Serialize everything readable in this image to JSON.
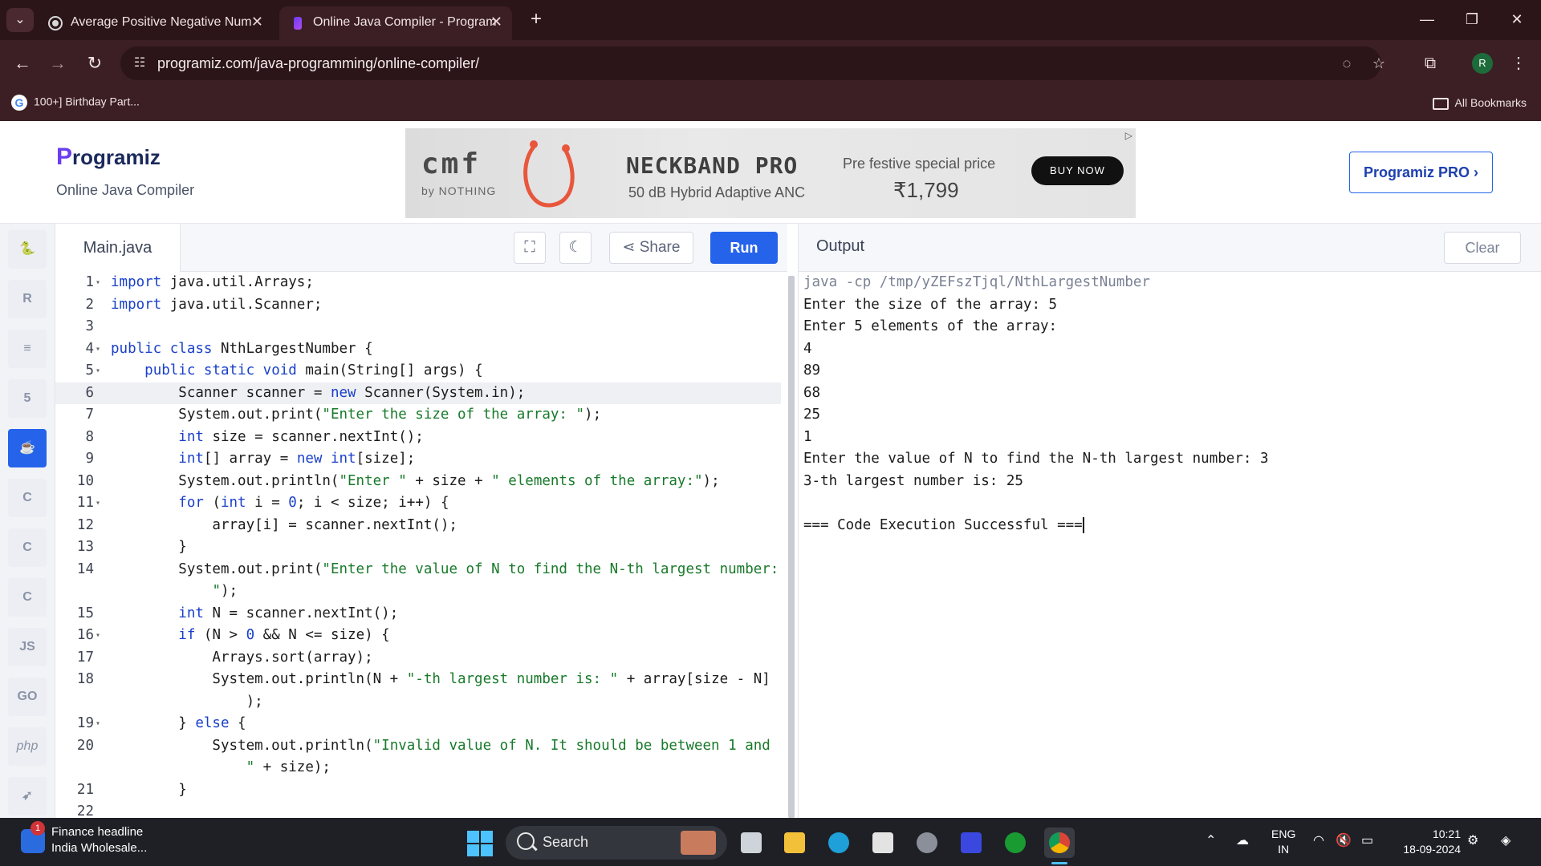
{
  "browser": {
    "tabs": [
      {
        "title": "Average Positive Negative Num"
      },
      {
        "title": "Online Java Compiler - Program"
      }
    ],
    "url": "programiz.com/java-programming/online-compiler/",
    "bookmark": "100+] Birthday Part...",
    "all_bookmarks": "All Bookmarks",
    "profile_initial": "R"
  },
  "site": {
    "logo": "rogramiz",
    "logo_p": "P",
    "subtitle": "Online Java Compiler",
    "pro_button": "Programiz PRO ›"
  },
  "ad": {
    "brand": "cmf",
    "brand_sub": "by NOTHING",
    "product": "NECKBAND PRO",
    "product_sub": "50 dB Hybrid Adaptive ANC",
    "promo": "Pre festive special price",
    "price": "₹1,799",
    "buy": "BUY NOW",
    "choices": "▷"
  },
  "languages": [
    "python-icon",
    "r-icon",
    "sql-icon",
    "html-icon",
    "java-icon",
    "c-icon",
    "cpp-icon",
    "csharp-icon",
    "JS",
    "GO",
    "php",
    "swift-icon"
  ],
  "editor": {
    "file": "Main.java",
    "share": "Share",
    "run": "Run"
  },
  "code_lines": [
    {
      "n": "1",
      "fold": true,
      "html": "<span class=\"kw\">import</span> java.util.Arrays;"
    },
    {
      "n": "2",
      "fold": false,
      "html": "<span class=\"kw\">import</span> java.util.Scanner;"
    },
    {
      "n": "3",
      "fold": false,
      "html": ""
    },
    {
      "n": "4",
      "fold": true,
      "html": "<span class=\"kw\">public class</span> NthLargestNumber {"
    },
    {
      "n": "5",
      "fold": true,
      "html": "    <span class=\"kw\">public static void</span> main(String[] args) {"
    },
    {
      "n": "6",
      "fold": false,
      "cur": true,
      "html": "        Scanner scanner = <span class=\"kw\">new</span> Scanner(System.in);"
    },
    {
      "n": "7",
      "fold": false,
      "html": "        System.out.print(<span class=\"str\">\"Enter the size of the array: \"</span>);"
    },
    {
      "n": "8",
      "fold": false,
      "html": "        <span class=\"kw\">int</span> size = scanner.nextInt();"
    },
    {
      "n": "9",
      "fold": false,
      "html": "        <span class=\"kw\">int</span>[] array = <span class=\"kw\">new int</span>[size];"
    },
    {
      "n": "10",
      "fold": false,
      "html": "        System.out.println(<span class=\"str\">\"Enter \"</span> + size + <span class=\"str\">\" elements of the array:\"</span>);"
    },
    {
      "n": "11",
      "fold": true,
      "html": "        <span class=\"kw\">for</span> (<span class=\"kw\">int</span> i = <span class=\"num\">0</span>; i &lt; size; i++) {"
    },
    {
      "n": "12",
      "fold": false,
      "html": "            array[i] = scanner.nextInt();"
    },
    {
      "n": "13",
      "fold": false,
      "html": "        }"
    },
    {
      "n": "14",
      "fold": false,
      "html": "        System.out.print(<span class=\"str\">\"Enter the value of N to find the N-th largest number:</span>"
    },
    {
      "n": "",
      "fold": false,
      "html": "            <span class=\"str\">\"</span>);"
    },
    {
      "n": "15",
      "fold": false,
      "html": "        <span class=\"kw\">int</span> N = scanner.nextInt();"
    },
    {
      "n": "16",
      "fold": true,
      "html": "        <span class=\"kw\">if</span> (N &gt; <span class=\"num\">0</span> &amp;&amp; N &lt;= size) {"
    },
    {
      "n": "17",
      "fold": false,
      "html": "            Arrays.sort(array);"
    },
    {
      "n": "18",
      "fold": false,
      "html": "            System.out.println(N + <span class=\"str\">\"-th largest number is: \"</span> + array[size - N]"
    },
    {
      "n": "",
      "fold": false,
      "html": "                );"
    },
    {
      "n": "19",
      "fold": true,
      "html": "        } <span class=\"kw\">else</span> {"
    },
    {
      "n": "20",
      "fold": false,
      "html": "            System.out.println(<span class=\"str\">\"Invalid value of N. It should be between 1 and</span>"
    },
    {
      "n": "",
      "fold": false,
      "html": "                <span class=\"str\">\"</span> + size);"
    },
    {
      "n": "21",
      "fold": false,
      "html": "        }"
    },
    {
      "n": "22",
      "fold": false,
      "html": ""
    }
  ],
  "output": {
    "title": "Output",
    "clear": "Clear",
    "lines": [
      "java -cp /tmp/yZEFszTjql/NthLargestNumber",
      "Enter the size of the array: 5",
      "Enter 5 elements of the array:",
      "4",
      "89",
      "68",
      "25",
      "1",
      "Enter the value of N to find the N-th largest number: 3",
      "3-th largest number is: 25",
      "",
      "=== Code Execution Successful ==="
    ]
  },
  "taskbar": {
    "news_title": "Finance headline",
    "news_sub": "India Wholesale...",
    "news_badge": "1",
    "search": "Search",
    "lang1": "ENG",
    "lang2": "IN",
    "time": "10:21",
    "date": "18-09-2024"
  }
}
